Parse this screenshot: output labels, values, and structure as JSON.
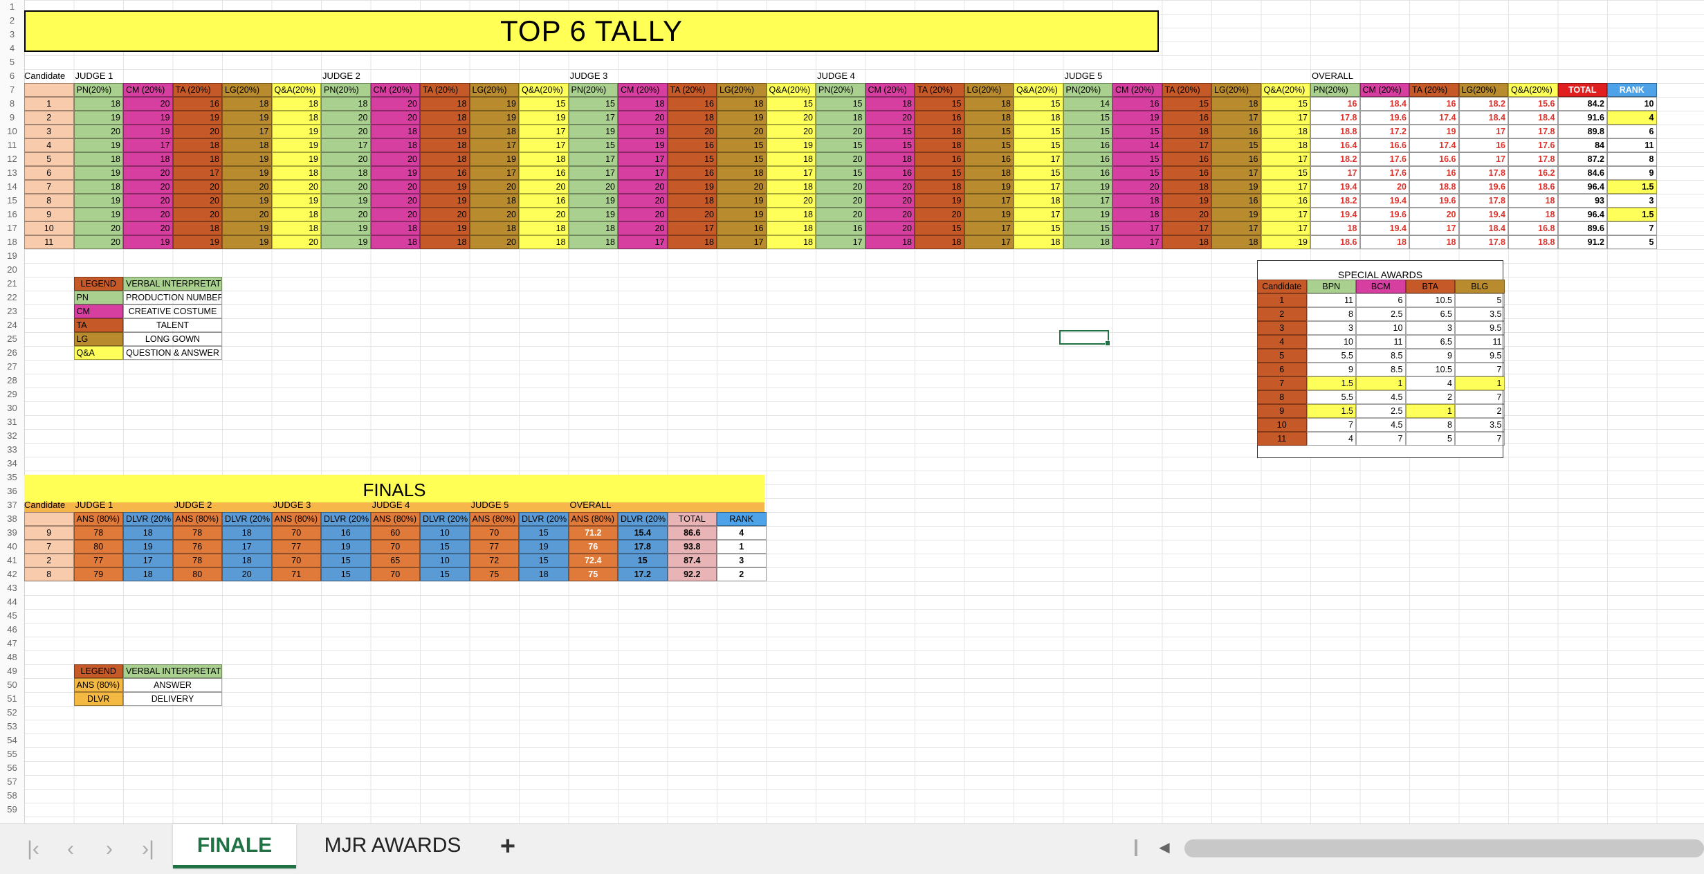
{
  "title": "TOP 6 TALLY",
  "tally": {
    "candidate_label": "Candidate",
    "judges": [
      "JUDGE 1",
      "JUDGE 2",
      "JUDGE 3",
      "JUDGE 4",
      "JUDGE 5",
      "OVERALL"
    ],
    "cat_headers": [
      "PN(20%)",
      "CM (20%)",
      "TA (20%)",
      "LG(20%)",
      "Q&A(20%)"
    ],
    "total_header": "TOTAL",
    "rank_header": "RANK",
    "rows": [
      {
        "cand": "1",
        "j": [
          [
            18,
            20,
            16,
            18,
            18
          ],
          [
            18,
            20,
            18,
            19,
            15
          ],
          [
            15,
            18,
            16,
            18,
            15
          ],
          [
            15,
            18,
            15,
            18,
            15
          ],
          [
            14,
            16,
            15,
            18,
            15
          ]
        ],
        "ov": [
          "16",
          "18.4",
          "16",
          "18.2",
          "15.6"
        ],
        "total": "84.2",
        "rank": "10"
      },
      {
        "cand": "2",
        "j": [
          [
            19,
            19,
            19,
            19,
            18
          ],
          [
            20,
            20,
            18,
            19,
            19
          ],
          [
            17,
            20,
            18,
            19,
            20
          ],
          [
            18,
            20,
            16,
            18,
            18
          ],
          [
            15,
            19,
            16,
            17,
            17
          ]
        ],
        "ov": [
          "17.8",
          "19.6",
          "17.4",
          "18.4",
          "18.4"
        ],
        "total": "91.6",
        "rank": "4"
      },
      {
        "cand": "3",
        "j": [
          [
            20,
            19,
            20,
            17,
            19
          ],
          [
            20,
            18,
            19,
            18,
            17
          ],
          [
            19,
            19,
            20,
            20,
            20
          ],
          [
            20,
            15,
            18,
            15,
            15
          ],
          [
            15,
            15,
            18,
            16,
            18
          ]
        ],
        "ov": [
          "18.8",
          "17.2",
          "19",
          "17",
          "17.8"
        ],
        "total": "89.8",
        "rank": "6"
      },
      {
        "cand": "4",
        "j": [
          [
            19,
            17,
            18,
            18,
            19
          ],
          [
            17,
            18,
            18,
            17,
            17
          ],
          [
            15,
            19,
            16,
            15,
            19
          ],
          [
            15,
            15,
            18,
            15,
            15
          ],
          [
            16,
            14,
            17,
            15,
            18
          ]
        ],
        "ov": [
          "16.4",
          "16.6",
          "17.4",
          "16",
          "17.6"
        ],
        "total": "84",
        "rank": "11"
      },
      {
        "cand": "5",
        "j": [
          [
            18,
            18,
            18,
            19,
            19
          ],
          [
            20,
            20,
            18,
            19,
            18
          ],
          [
            17,
            17,
            15,
            15,
            18
          ],
          [
            20,
            18,
            16,
            16,
            17
          ],
          [
            16,
            15,
            16,
            16,
            17
          ]
        ],
        "ov": [
          "18.2",
          "17.6",
          "16.6",
          "17",
          "17.8"
        ],
        "total": "87.2",
        "rank": "8"
      },
      {
        "cand": "6",
        "j": [
          [
            19,
            20,
            17,
            19,
            18
          ],
          [
            18,
            19,
            16,
            17,
            16
          ],
          [
            17,
            17,
            16,
            18,
            17
          ],
          [
            15,
            16,
            15,
            18,
            15
          ],
          [
            16,
            15,
            16,
            17,
            15
          ]
        ],
        "ov": [
          "17",
          "17.6",
          "16",
          "17.8",
          "16.2"
        ],
        "total": "84.6",
        "rank": "9"
      },
      {
        "cand": "7",
        "j": [
          [
            18,
            20,
            20,
            20,
            20
          ],
          [
            20,
            20,
            19,
            20,
            20
          ],
          [
            20,
            20,
            19,
            20,
            18
          ],
          [
            20,
            20,
            18,
            19,
            17
          ],
          [
            19,
            20,
            18,
            19,
            17
          ]
        ],
        "ov": [
          "19.4",
          "20",
          "18.8",
          "19.6",
          "18.6"
        ],
        "total": "96.4",
        "rank": "1.5"
      },
      {
        "cand": "8",
        "j": [
          [
            19,
            20,
            20,
            19,
            19
          ],
          [
            19,
            20,
            19,
            18,
            16
          ],
          [
            19,
            20,
            18,
            19,
            20
          ],
          [
            20,
            20,
            19,
            17,
            18
          ],
          [
            17,
            18,
            19,
            16,
            16
          ]
        ],
        "ov": [
          "18.2",
          "19.4",
          "19.6",
          "17.8",
          "18"
        ],
        "total": "93",
        "rank": "3"
      },
      {
        "cand": "9",
        "j": [
          [
            19,
            20,
            20,
            20,
            18
          ],
          [
            20,
            20,
            20,
            20,
            20
          ],
          [
            19,
            20,
            20,
            19,
            18
          ],
          [
            20,
            20,
            20,
            19,
            17
          ],
          [
            19,
            18,
            20,
            19,
            17
          ]
        ],
        "ov": [
          "19.4",
          "19.6",
          "20",
          "19.4",
          "18"
        ],
        "total": "96.4",
        "rank": "1.5"
      },
      {
        "cand": "10",
        "j": [
          [
            20,
            20,
            18,
            19,
            18
          ],
          [
            19,
            18,
            19,
            18,
            18
          ],
          [
            18,
            20,
            17,
            16,
            18
          ],
          [
            16,
            20,
            15,
            17,
            15
          ],
          [
            15,
            17,
            17,
            17,
            17
          ]
        ],
        "ov": [
          "18",
          "19.4",
          "17",
          "18.4",
          "16.8"
        ],
        "total": "89.6",
        "rank": "7"
      },
      {
        "cand": "11",
        "j": [
          [
            20,
            19,
            19,
            19,
            20
          ],
          [
            19,
            18,
            18,
            20,
            18
          ],
          [
            18,
            17,
            18,
            17,
            18
          ],
          [
            17,
            18,
            18,
            17,
            18
          ],
          [
            18,
            17,
            18,
            18,
            19
          ]
        ],
        "ov": [
          "18.6",
          "18",
          "18",
          "17.8",
          "18.8"
        ],
        "total": "91.2",
        "rank": "5"
      }
    ]
  },
  "legend1": {
    "header_left": "LEGEND",
    "header_right": "VERBAL INTERPRETATION",
    "rows": [
      {
        "abbr": "PN",
        "desc": "PRODUCTION NUMBER"
      },
      {
        "abbr": "CM",
        "desc": "CREATIVE COSTUME"
      },
      {
        "abbr": "TA",
        "desc": "TALENT"
      },
      {
        "abbr": "LG",
        "desc": "LONG GOWN"
      },
      {
        "abbr": "Q&A",
        "desc": "QUESTION & ANSWER"
      }
    ]
  },
  "special_awards": {
    "title": "SPECIAL AWARDS",
    "headers": [
      "Candidate",
      "BPN",
      "BCM",
      "BTA",
      "BLG"
    ],
    "rows": [
      [
        "1",
        "11",
        "6",
        "10.5",
        "5"
      ],
      [
        "2",
        "8",
        "2.5",
        "6.5",
        "3.5"
      ],
      [
        "3",
        "3",
        "10",
        "3",
        "9.5"
      ],
      [
        "4",
        "10",
        "11",
        "6.5",
        "11"
      ],
      [
        "5",
        "5.5",
        "8.5",
        "9",
        "9.5"
      ],
      [
        "6",
        "9",
        "8.5",
        "10.5",
        "7"
      ],
      [
        "7",
        "1.5",
        "1",
        "4",
        "1"
      ],
      [
        "8",
        "5.5",
        "4.5",
        "2",
        "7"
      ],
      [
        "9",
        "1.5",
        "2.5",
        "1",
        "2"
      ],
      [
        "10",
        "7",
        "4.5",
        "8",
        "3.5"
      ],
      [
        "11",
        "4",
        "7",
        "5",
        "7"
      ]
    ]
  },
  "finals": {
    "title": "FINALS",
    "candidate_label": "Candidate",
    "judges": [
      "JUDGE 1",
      "JUDGE 2",
      "JUDGE 3",
      "JUDGE 4",
      "JUDGE 5",
      "OVERALL"
    ],
    "ans_header": "ANS (80%)",
    "dlvr_header": "DLVR (20%",
    "total_header": "TOTAL",
    "rank_header": "RANK",
    "rows": [
      {
        "cand": "9",
        "j": [
          [
            "78",
            "18"
          ],
          [
            "78",
            "18"
          ],
          [
            "70",
            "16"
          ],
          [
            "60",
            "10"
          ],
          [
            "70",
            "15"
          ]
        ],
        "ov": [
          "71.2",
          "15.4"
        ],
        "total": "86.6",
        "rank": "4"
      },
      {
        "cand": "7",
        "j": [
          [
            "80",
            "19"
          ],
          [
            "76",
            "17"
          ],
          [
            "77",
            "19"
          ],
          [
            "70",
            "15"
          ],
          [
            "77",
            "19"
          ]
        ],
        "ov": [
          "76",
          "17.8"
        ],
        "total": "93.8",
        "rank": "1"
      },
      {
        "cand": "2",
        "j": [
          [
            "77",
            "17"
          ],
          [
            "78",
            "18"
          ],
          [
            "70",
            "15"
          ],
          [
            "65",
            "10"
          ],
          [
            "72",
            "15"
          ]
        ],
        "ov": [
          "72.4",
          "15"
        ],
        "total": "87.4",
        "rank": "3"
      },
      {
        "cand": "8",
        "j": [
          [
            "79",
            "18"
          ],
          [
            "80",
            "20"
          ],
          [
            "71",
            "15"
          ],
          [
            "70",
            "15"
          ],
          [
            "75",
            "18"
          ]
        ],
        "ov": [
          "75",
          "17.2"
        ],
        "total": "92.2",
        "rank": "2"
      }
    ]
  },
  "legend2": {
    "header_left": "LEGEND",
    "header_right": "VERBAL INTERPRETATION",
    "rows": [
      {
        "abbr": "ANS (80%)",
        "desc": "ANSWER"
      },
      {
        "abbr": "DLVR",
        "desc": "DELIVERY"
      }
    ]
  },
  "sheet_tabs": [
    "FINALE",
    "MJR AWARDS"
  ],
  "active_tab": "FINALE",
  "add_sheet_label": "+",
  "nav_icons": [
    "first-sheet-icon",
    "prev-sheet-icon",
    "next-sheet-icon",
    "last-sheet-icon"
  ],
  "row_count": 59
}
